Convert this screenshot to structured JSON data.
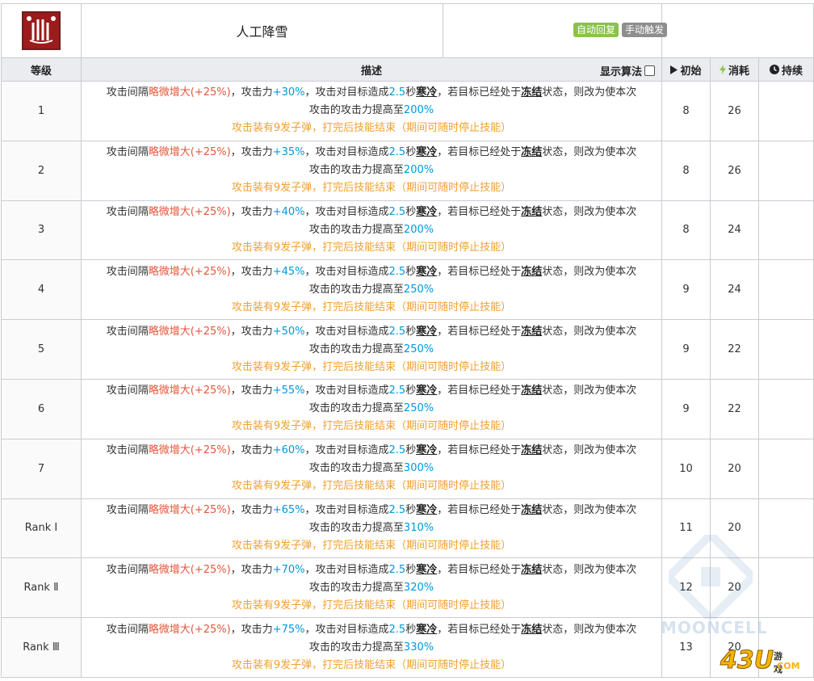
{
  "skill": {
    "name": "人工降雪",
    "tags": [
      "自动回复",
      "手动触发"
    ]
  },
  "columns": {
    "level": "等级",
    "description": "描述",
    "show_algo": "显示算法",
    "initial": "初始",
    "cost": "消耗",
    "duration": "持续"
  },
  "text": {
    "p1": "攻击间隔",
    "interval": "略微增大(+25%)",
    "p2": "，攻击力",
    "p3": "，攻击对目标造成",
    "cold_time": "2.5",
    "p4": "秒",
    "cold": "寒冷",
    "p5": "，若目标已经处于",
    "frozen": "冻结",
    "p6": "状态，则改为使本次",
    "p7": "攻击的攻击力提高至",
    "note": "攻击装有9发子弹，打完后技能结束（期间可随时停止技能）"
  },
  "rows": [
    {
      "level": "1",
      "atk": "+30%",
      "boost": "200%",
      "initial": "8",
      "cost": "26",
      "duration": ""
    },
    {
      "level": "2",
      "atk": "+35%",
      "boost": "200%",
      "initial": "8",
      "cost": "26",
      "duration": ""
    },
    {
      "level": "3",
      "atk": "+40%",
      "boost": "200%",
      "initial": "8",
      "cost": "24",
      "duration": ""
    },
    {
      "level": "4",
      "atk": "+45%",
      "boost": "250%",
      "initial": "9",
      "cost": "24",
      "duration": ""
    },
    {
      "level": "5",
      "atk": "+50%",
      "boost": "250%",
      "initial": "9",
      "cost": "22",
      "duration": ""
    },
    {
      "level": "6",
      "atk": "+55%",
      "boost": "250%",
      "initial": "9",
      "cost": "22",
      "duration": ""
    },
    {
      "level": "7",
      "atk": "+60%",
      "boost": "300%",
      "initial": "10",
      "cost": "20",
      "duration": ""
    },
    {
      "level": "Rank Ⅰ",
      "atk": "+65%",
      "boost": "310%",
      "initial": "11",
      "cost": "20",
      "duration": ""
    },
    {
      "level": "Rank Ⅱ",
      "atk": "+70%",
      "boost": "320%",
      "initial": "12",
      "cost": "20",
      "duration": ""
    },
    {
      "level": "Rank Ⅲ",
      "atk": "+75%",
      "boost": "330%",
      "initial": "13",
      "cost": "20",
      "duration": ""
    }
  ],
  "watermark": {
    "mooncell": "MOONCELL",
    "logo_num": "43U",
    "logo_cn": "游戏",
    "logo_dom": ".COM"
  },
  "colors": {
    "red": "#e4573c",
    "blue": "#0098dc",
    "note": "#f0a030",
    "green_tag": "#8ac34a",
    "gray_tag": "#8e8e8e"
  },
  "icons": {
    "play": "play-icon",
    "bolt": "bolt-icon",
    "clock": "clock-icon",
    "skill": "skill-icon"
  }
}
